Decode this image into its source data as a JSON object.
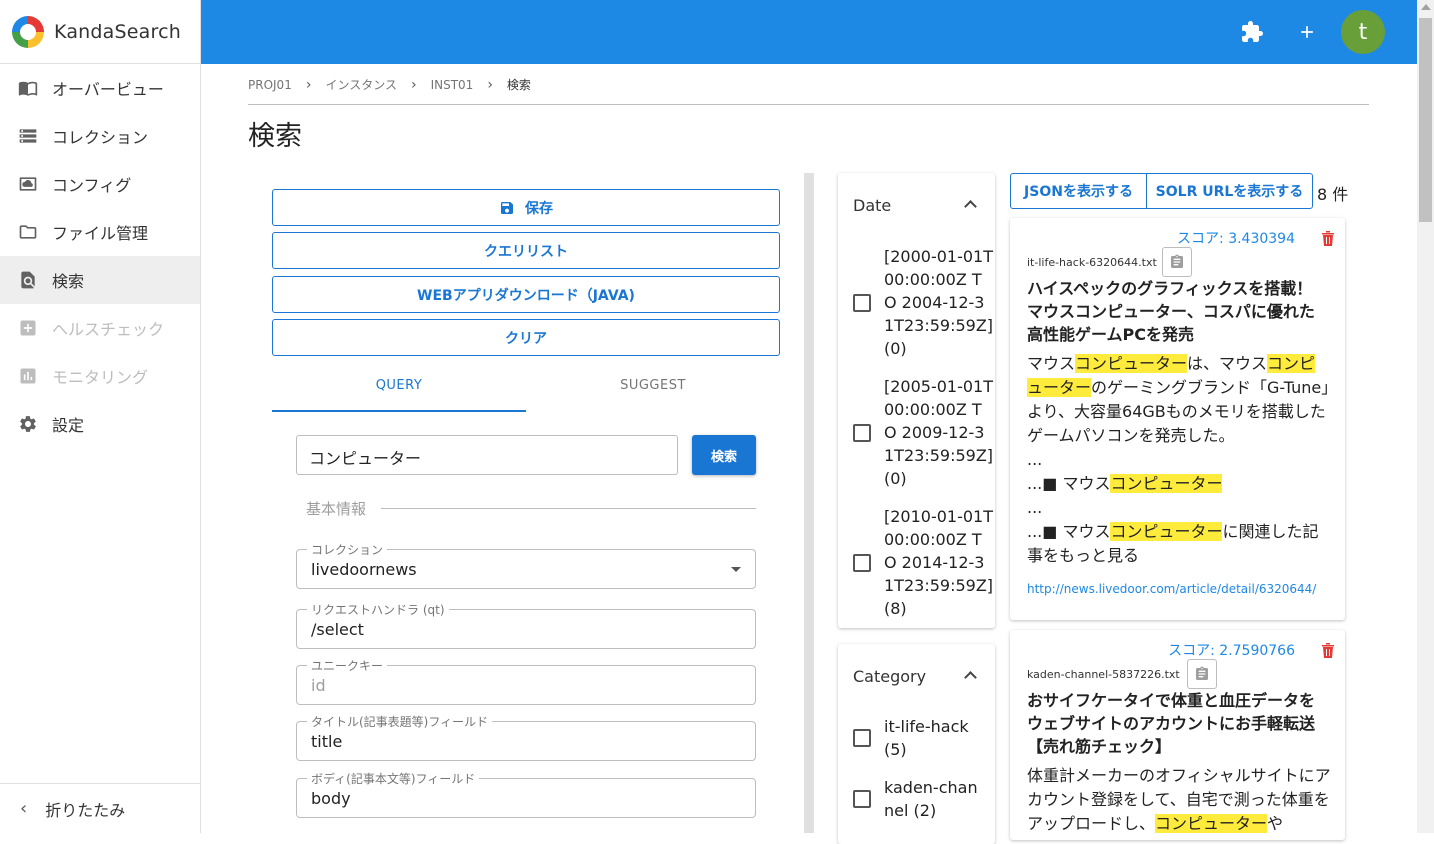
{
  "app": {
    "title": "KandaSearch",
    "avatar_letter": "t",
    "brand_color": "#1e88e5"
  },
  "sidebar": {
    "items": [
      {
        "label": "オーバービュー",
        "icon": "book-icon",
        "state": "normal"
      },
      {
        "label": "コレクション",
        "icon": "storage-icon",
        "state": "normal"
      },
      {
        "label": "コンフィグ",
        "icon": "cloud-icon",
        "state": "normal"
      },
      {
        "label": "ファイル管理",
        "icon": "folder-icon",
        "state": "normal"
      },
      {
        "label": "検索",
        "icon": "search-doc-icon",
        "state": "active"
      },
      {
        "label": "ヘルスチェック",
        "icon": "plus-box-icon",
        "state": "disabled"
      },
      {
        "label": "モニタリング",
        "icon": "chart-icon",
        "state": "disabled"
      },
      {
        "label": "設定",
        "icon": "gear-icon",
        "state": "normal"
      }
    ],
    "collapse_label": "折りたたみ"
  },
  "breadcrumb": [
    "PROJ01",
    "インスタンス",
    "INST01",
    "検索"
  ],
  "page_title": "検索",
  "actions": {
    "save": "保存",
    "query_list": "クエリリスト",
    "web_download": "WEBアプリダウンロード（JAVA)",
    "clear": "クリア"
  },
  "tabs": {
    "query": "QUERY",
    "suggest": "SUGGEST"
  },
  "query": {
    "value": "コンピューター",
    "button": "検索"
  },
  "basic_section": "基本情報",
  "fields": {
    "collection": {
      "label": "コレクション",
      "value": "livedoornews"
    },
    "handler": {
      "label": "リクエストハンドラ (qt)",
      "value": "/select"
    },
    "unique_key": {
      "label": "ユニークキー",
      "placeholder": "id"
    },
    "title_field": {
      "label": "タイトル(記事表題等)フィールド",
      "value": "title"
    },
    "body_field": {
      "label": "ボディ(記事本文等)フィールド",
      "value": "body"
    }
  },
  "facets": {
    "date": {
      "title": "Date",
      "options": [
        "[2000-01-01T00:00:00Z TO 2004-12-31T23:59:59Z] (0)",
        "[2005-01-01T00:00:00Z TO 2009-12-31T23:59:59Z] (0)",
        "[2010-01-01T00:00:00Z TO 2014-12-31T23:59:59Z] (8)"
      ]
    },
    "category": {
      "title": "Category",
      "options": [
        "it-life-hack (5)",
        "kaden-channel (2)"
      ]
    }
  },
  "results": {
    "json_button": "JSONを表示する",
    "solr_button": "SOLR URLを表示する",
    "count": "8 件",
    "items": [
      {
        "score": "スコア: 3.430394",
        "file": "it-life-hack-6320644.txt",
        "title": "ハイスペックのグラフィックスを搭載！マウスコンピューター、コスパに優れた高性能ゲームPCを発売",
        "body": [
          {
            "t": "マウス"
          },
          {
            "t": "コンピューター",
            "h": true
          },
          {
            "t": "は、マウス"
          },
          {
            "t": "コンピューター",
            "h": true
          },
          {
            "t": "のゲーミングブランド「G-Tune」より、大容量64GBものメモリを搭載したゲームパソコンを発売した。"
          },
          {
            "t": "\n...\n...■ マウス"
          },
          {
            "t": "コンピューター",
            "h": true
          },
          {
            "t": "\n...\n...■ マウス"
          },
          {
            "t": "コンピューター",
            "h": true
          },
          {
            "t": "に関連した記事をもっと見る"
          }
        ],
        "url": "http://news.livedoor.com/article/detail/6320644/"
      },
      {
        "score": "スコア: 2.7590766",
        "file": "kaden-channel-5837226.txt",
        "title": "おサイフケータイで体重と血圧データをウェブサイトのアカウントにお手軽転送【売れ筋チェック】",
        "body": [
          {
            "t": "体重計メーカーのオフィシャルサイトにアカウント登録をして、自宅で測った体重をアップロードし、"
          },
          {
            "t": "コンピューター",
            "h": true
          },
          {
            "t": "や"
          }
        ],
        "url": ""
      }
    ]
  }
}
